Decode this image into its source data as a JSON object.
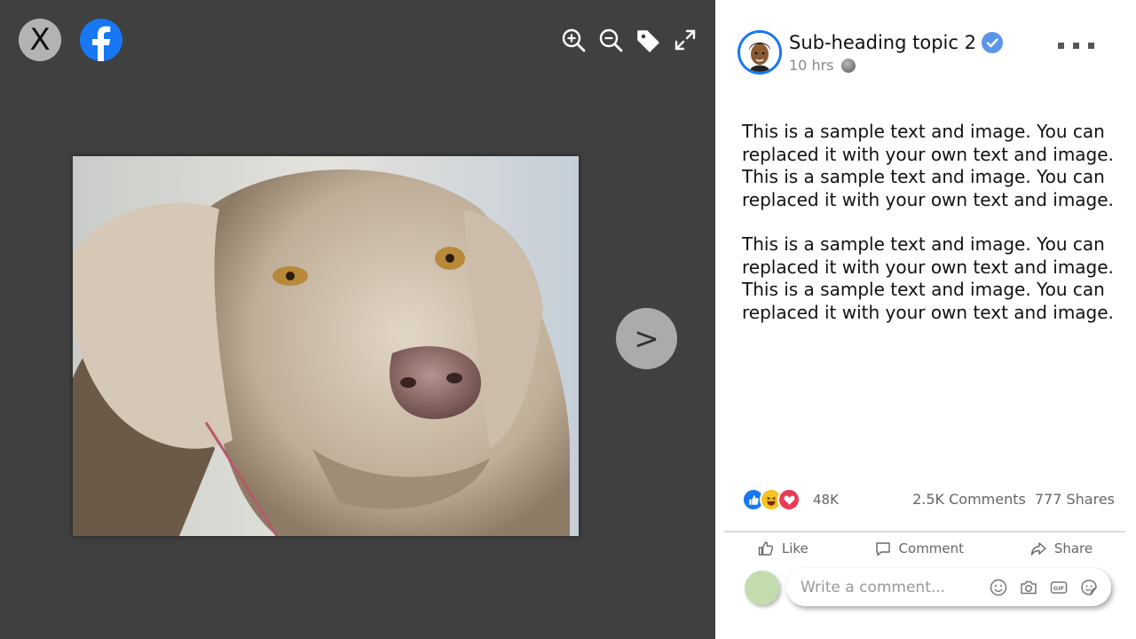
{
  "viewer": {
    "close_label": "X",
    "next_label": ">",
    "toolbar": [
      "zoom-in-icon",
      "zoom-out-icon",
      "tag-icon",
      "fullscreen-icon"
    ],
    "photo_subject": "weimaraner dog portrait"
  },
  "post": {
    "title": "Sub-heading topic 2",
    "time": "10 hrs",
    "paragraphs": [
      "This is a sample text and image. You can replaced it with your own text and image. This is a sample text and image. You can replaced it with your own text and image.",
      "This is a sample text and image. You can replaced it with your own text and image. This is a sample text and image. You can replaced it with your own text and image."
    ],
    "reaction_count": "48K",
    "comments": "2.5K Comments",
    "shares": "777 Shares"
  },
  "actions": {
    "like": "Like",
    "comment": "Comment",
    "share": "Share"
  },
  "comment_box": {
    "placeholder": "Write a comment..."
  },
  "colors": {
    "viewer_bg": "#404040",
    "brand": "#1877f2",
    "verified": "#5b95e8"
  }
}
